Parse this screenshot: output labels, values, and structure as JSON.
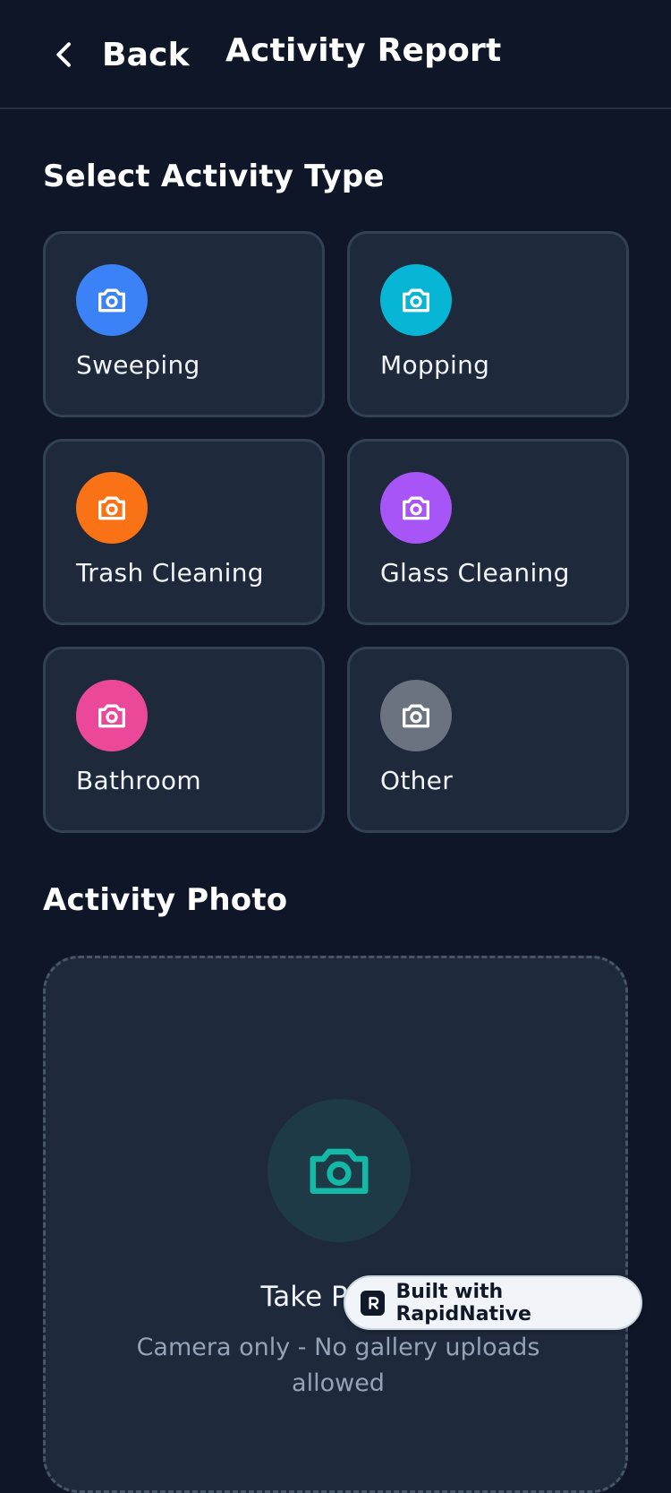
{
  "header": {
    "back_label": "Back",
    "title": "Activity Report"
  },
  "activity_section": {
    "title": "Select Activity Type",
    "items": [
      {
        "label": "Sweeping",
        "icon": "camera-icon",
        "color": "#3b82f6"
      },
      {
        "label": "Mopping",
        "icon": "camera-icon",
        "color": "#06b6d4"
      },
      {
        "label": "Trash Cleaning",
        "icon": "camera-icon",
        "color": "#f97316"
      },
      {
        "label": "Glass Cleaning",
        "icon": "camera-icon",
        "color": "#a855f7"
      },
      {
        "label": "Bathroom",
        "icon": "camera-icon",
        "color": "#ec4899"
      },
      {
        "label": "Other",
        "icon": "camera-icon",
        "color": "#6b7280"
      }
    ]
  },
  "photo_section": {
    "title": "Activity Photo",
    "action_label": "Take Photo",
    "note": "Camera only - No gallery uploads allowed",
    "accent_color": "#14b8a6"
  },
  "badge": {
    "label": "Built with RapidNative"
  }
}
